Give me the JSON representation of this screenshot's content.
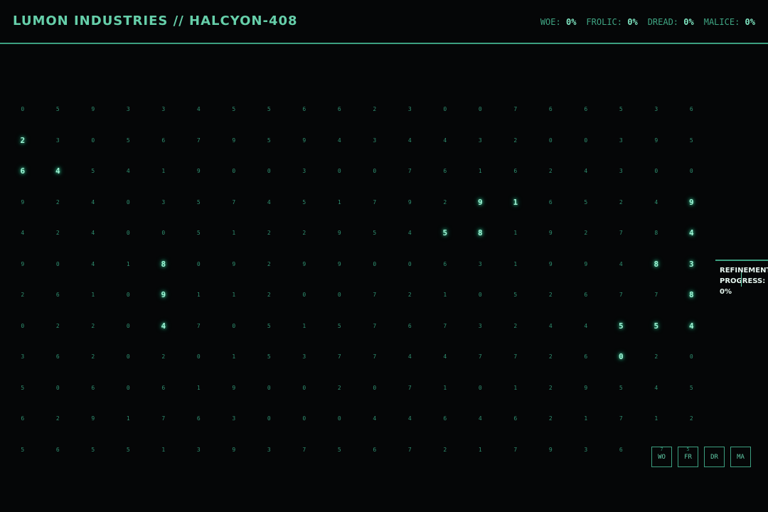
{
  "header": {
    "title": "LUMON INDUSTRIES // HALCYON-408",
    "stats": [
      {
        "label": "WOE:",
        "value": "0%"
      },
      {
        "label": "FROLIC:",
        "value": "0%"
      },
      {
        "label": "DREAD:",
        "value": "0%"
      },
      {
        "label": "MALICE:",
        "value": "0%"
      }
    ]
  },
  "grid": {
    "rows": [
      [
        "0",
        "5",
        "9",
        "3",
        "3",
        "4",
        "5",
        "5",
        "6",
        "6",
        "2",
        "3",
        "0",
        "0",
        "7",
        "6",
        "6",
        "5",
        "3",
        "6"
      ],
      [
        "2",
        "3",
        "0",
        "5",
        "6",
        "7",
        "9",
        "5",
        "9",
        "4",
        "3",
        "4",
        "4",
        "3",
        "2",
        "0",
        "0",
        "3",
        "9",
        "5"
      ],
      [
        "6",
        "4",
        "5",
        "4",
        "1",
        "9",
        "0",
        "0",
        "3",
        "0",
        "0",
        "7",
        "6",
        "1",
        "6",
        "2",
        "4",
        "3",
        "0",
        "0"
      ],
      [
        "9",
        "2",
        "4",
        "0",
        "3",
        "5",
        "7",
        "4",
        "5",
        "1",
        "7",
        "9",
        "2",
        "9",
        "1",
        "6",
        "5",
        "2",
        "4",
        "9"
      ],
      [
        "4",
        "2",
        "4",
        "0",
        "0",
        "5",
        "1",
        "2",
        "2",
        "9",
        "5",
        "4",
        "5",
        "8",
        "1",
        "9",
        "2",
        "7",
        "8",
        "4"
      ],
      [
        "9",
        "0",
        "4",
        "1",
        "8",
        "0",
        "9",
        "2",
        "9",
        "9",
        "0",
        "0",
        "6",
        "3",
        "1",
        "9",
        "9",
        "4",
        "8",
        "3"
      ],
      [
        "2",
        "6",
        "1",
        "0",
        "9",
        "1",
        "1",
        "2",
        "0",
        "0",
        "7",
        "2",
        "1",
        "0",
        "5",
        "2",
        "6",
        "7",
        "7",
        "8"
      ],
      [
        "0",
        "2",
        "2",
        "0",
        "4",
        "7",
        "0",
        "5",
        "1",
        "5",
        "7",
        "6",
        "7",
        "3",
        "2",
        "4",
        "4",
        "5",
        "5",
        "4"
      ],
      [
        "3",
        "6",
        "2",
        "0",
        "2",
        "0",
        "1",
        "5",
        "3",
        "7",
        "7",
        "4",
        "4",
        "7",
        "7",
        "2",
        "6",
        "0",
        "2",
        "0"
      ],
      [
        "5",
        "0",
        "6",
        "0",
        "6",
        "1",
        "9",
        "0",
        "0",
        "2",
        "0",
        "7",
        "1",
        "0",
        "1",
        "2",
        "9",
        "5",
        "4",
        "5"
      ],
      [
        "6",
        "2",
        "9",
        "1",
        "7",
        "6",
        "3",
        "0",
        "0",
        "0",
        "4",
        "4",
        "6",
        "4",
        "6",
        "2",
        "1",
        "7",
        "1",
        "2"
      ],
      [
        "5",
        "6",
        "5",
        "5",
        "1",
        "3",
        "9",
        "3",
        "7",
        "5",
        "6",
        "7",
        "2",
        "1",
        "7",
        "9",
        "3",
        "6",
        "7",
        "5"
      ]
    ],
    "highlighted": [
      [
        1,
        0
      ],
      [
        2,
        0
      ],
      [
        2,
        1
      ],
      [
        3,
        13
      ],
      [
        3,
        14
      ],
      [
        3,
        19
      ],
      [
        4,
        12
      ],
      [
        4,
        13
      ],
      [
        4,
        19
      ],
      [
        5,
        4
      ],
      [
        5,
        18
      ],
      [
        5,
        19
      ],
      [
        6,
        4
      ],
      [
        6,
        19
      ],
      [
        7,
        4
      ],
      [
        7,
        17
      ],
      [
        7,
        18
      ],
      [
        7,
        19
      ],
      [
        8,
        17
      ]
    ]
  },
  "progress": {
    "label_line1": "REFINEMENT",
    "label_line2": "PROGRESS:",
    "value": "0%"
  },
  "bins": [
    {
      "label": "WO",
      "peek": "7"
    },
    {
      "label": "FR",
      "peek": "5"
    },
    {
      "label": "DR",
      "peek": ""
    },
    {
      "label": "MA",
      "peek": ""
    }
  ]
}
